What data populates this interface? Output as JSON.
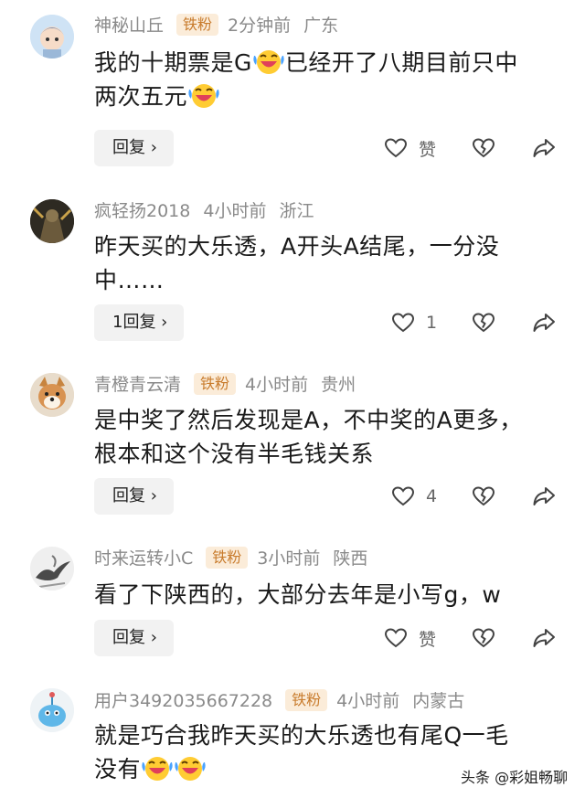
{
  "comments": [
    {
      "username": "神秘山丘",
      "badge": "铁粉",
      "time": "2分钟前",
      "location": "广东",
      "line1_a": "我的十期票是G",
      "line1_b": "已经开了八期目前只中",
      "line2": "两次五元",
      "reply_label": "回复 ›",
      "like_label": "赞",
      "avatar": "cartoon-child-avatar"
    },
    {
      "username": "疯轻扬2018",
      "time": "4小时前",
      "location": "浙江",
      "line1": "昨天买的大乐透，A开头A结尾，一分没",
      "line2": "中……",
      "reply_label": "1回复 ›",
      "like_label": "1",
      "avatar": "dark-figure-avatar"
    },
    {
      "username": "青橙青云清",
      "badge": "铁粉",
      "time": "4小时前",
      "location": "贵州",
      "line1": "是中奖了然后发现是A，不中奖的A更多，",
      "line2": "根本和这个没有半毛钱关系",
      "reply_label": "回复 ›",
      "like_label": "4",
      "avatar": "shiba-dog-avatar"
    },
    {
      "username": "时来运转小C",
      "badge": "铁粉",
      "time": "3小时前",
      "location": "陕西",
      "line1": "看了下陕西的，大部分去年是小写g，w",
      "reply_label": "回复 ›",
      "like_label": "赞",
      "avatar": "ink-bird-avatar"
    },
    {
      "username": "用户3492035667228",
      "badge": "铁粉",
      "time": "4小时前",
      "location": "内蒙古",
      "line1": "就是巧合我昨天买的大乐透也有尾Q一毛",
      "line2": "没有",
      "avatar": "blue-creature-avatar"
    }
  ],
  "icons": {
    "like": "heart-outline-icon",
    "dislike": "broken-heart-icon",
    "share": "share-arrow-icon",
    "emoji": "laughing-crying-emoji"
  },
  "watermark": "头条 @彩姐畅聊",
  "colors": {
    "badge_bg": "#fbecd9",
    "badge_text": "#c87b2c",
    "meta": "#8a8a8a"
  }
}
